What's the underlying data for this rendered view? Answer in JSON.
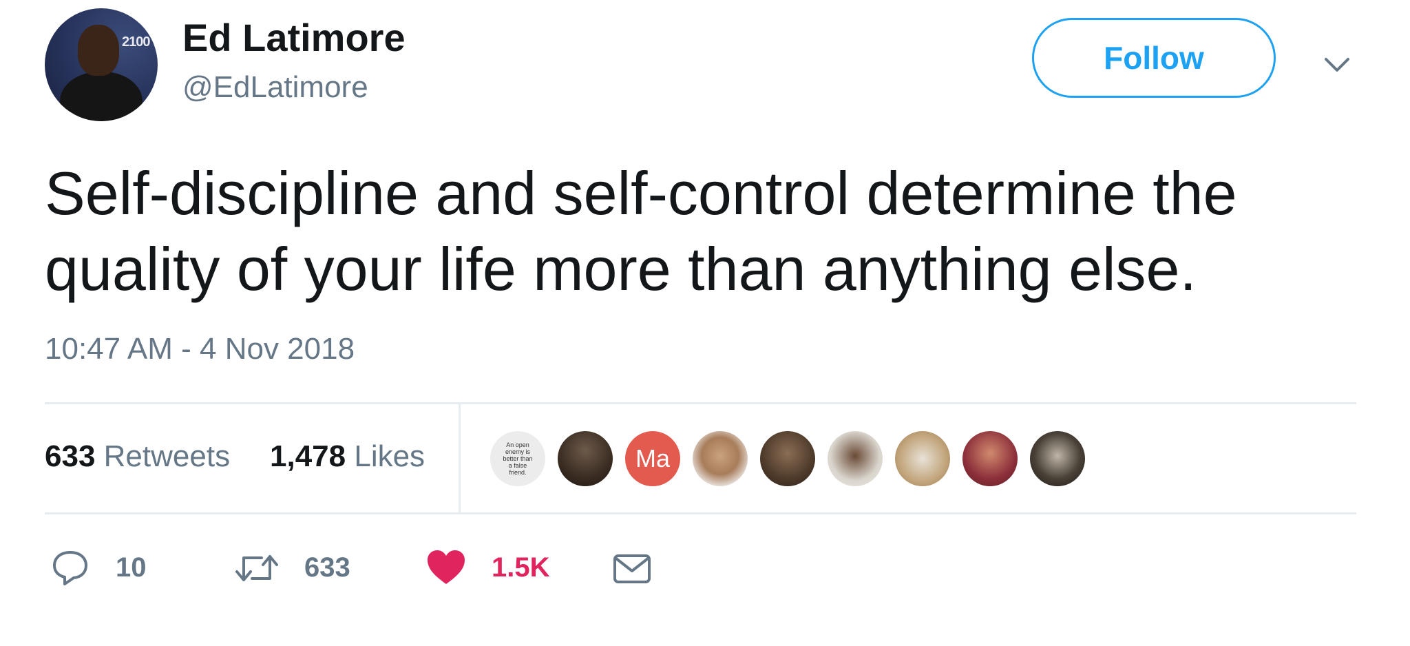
{
  "author": {
    "display_name": "Ed Latimore",
    "handle": "@EdLatimore",
    "avatar_banner_text": "2100"
  },
  "follow_button": {
    "label": "Follow"
  },
  "tweet": {
    "text": "Self-discipline and self-control determine the quality of your life more than anything else.",
    "timestamp": "10:47 AM - 4 Nov 2018"
  },
  "stats": {
    "retweets_count": "633",
    "retweets_label": "Retweets",
    "likes_count": "1,478",
    "likes_label": "Likes"
  },
  "likers": {
    "text_avatar_text": "An open enemy is better than a false friend.",
    "ma_avatar_text": "Ma"
  },
  "actions": {
    "reply_count": "10",
    "retweet_count": "633",
    "like_count": "1.5K"
  },
  "colors": {
    "accent": "#1da1f2",
    "like": "#e0245e",
    "secondary_text": "#657786",
    "divider": "#e6ecf0"
  },
  "icons": [
    "chevron-down-icon",
    "reply-icon",
    "retweet-icon",
    "heart-icon",
    "message-icon"
  ]
}
